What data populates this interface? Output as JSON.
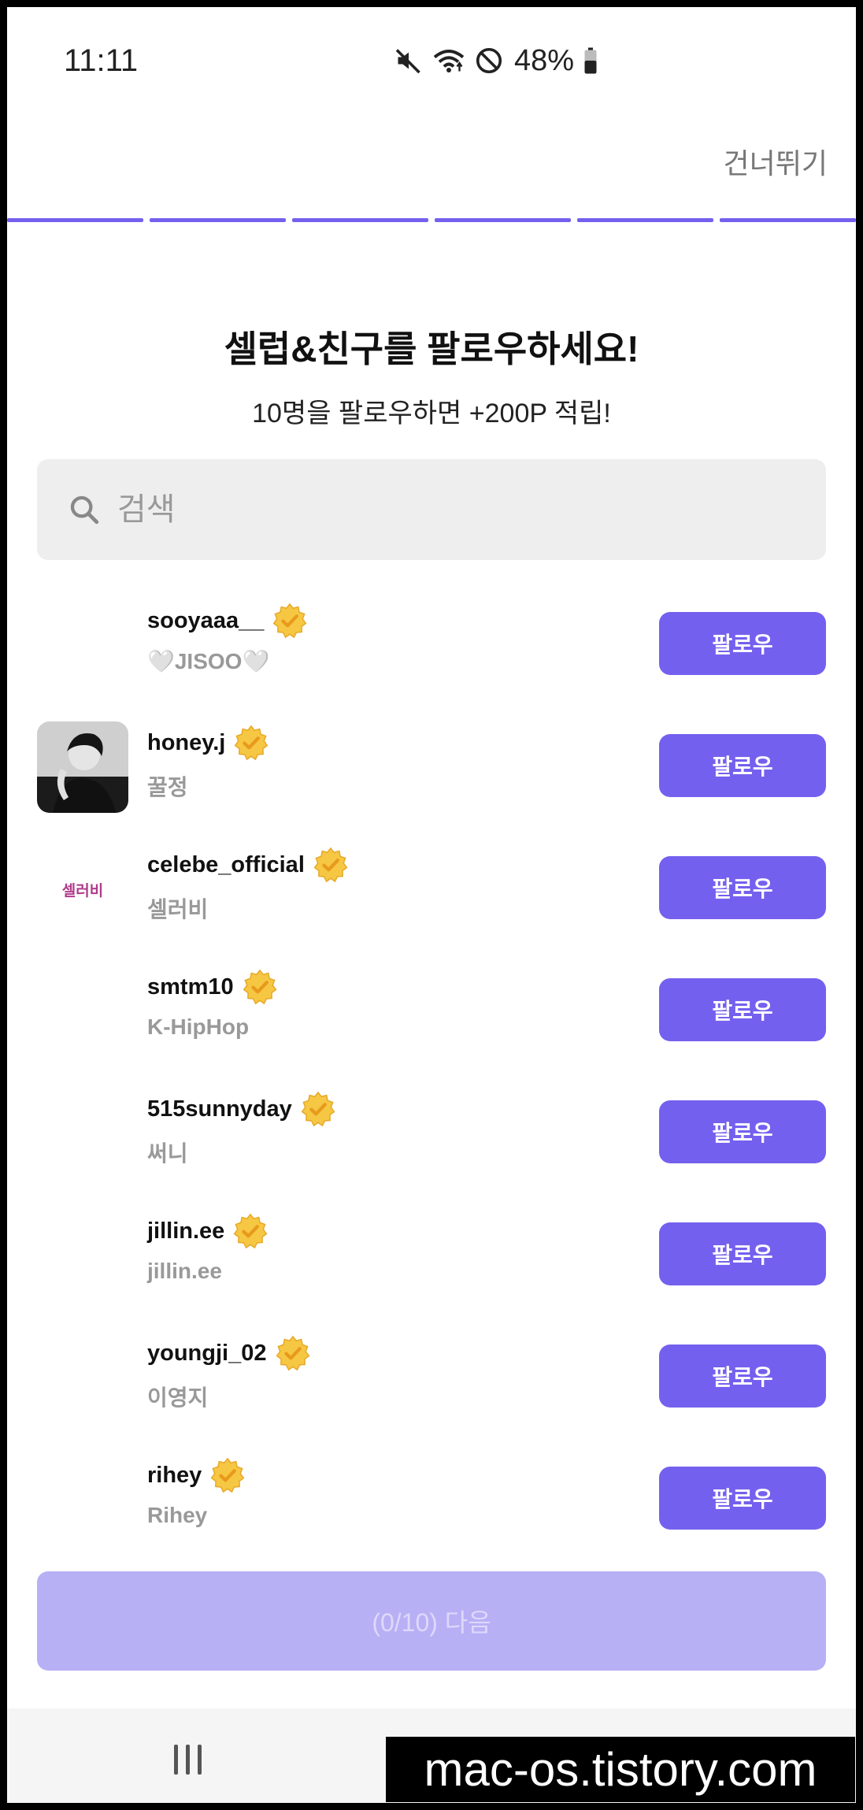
{
  "status_bar": {
    "time": "11:11",
    "battery": "48%"
  },
  "header": {
    "skip_label": "건너뛰기",
    "progress_steps": 6,
    "accent_color": "#7460ee"
  },
  "title": "셀럽&친구를 팔로우하세요!",
  "subtitle": "10명을 팔로우하면 +200P 적립!",
  "search": {
    "placeholder": "검색",
    "value": ""
  },
  "users": [
    {
      "username": "sooyaaa__",
      "display_name": "🤍JISOO🤍",
      "verified": true,
      "follow_label": "팔로우"
    },
    {
      "username": "honey.j",
      "display_name": "꿀정",
      "verified": true,
      "follow_label": "팔로우"
    },
    {
      "username": "celebe_official",
      "display_name": "셀러비",
      "verified": true,
      "follow_label": "팔로우",
      "avatar_text": "셀러비"
    },
    {
      "username": "smtm10",
      "display_name": "K-HipHop",
      "verified": true,
      "follow_label": "팔로우"
    },
    {
      "username": "515sunnyday",
      "display_name": "써니",
      "verified": true,
      "follow_label": "팔로우"
    },
    {
      "username": "jillin.ee",
      "display_name": "jillin.ee",
      "verified": true,
      "follow_label": "팔로우"
    },
    {
      "username": "youngji_02",
      "display_name": "이영지",
      "verified": true,
      "follow_label": "팔로우"
    },
    {
      "username": "rihey",
      "display_name": "Rihey",
      "verified": true,
      "follow_label": "팔로우"
    }
  ],
  "next_button": {
    "label": "(0/10) 다음"
  },
  "watermark": "mac-os.tistory.com"
}
